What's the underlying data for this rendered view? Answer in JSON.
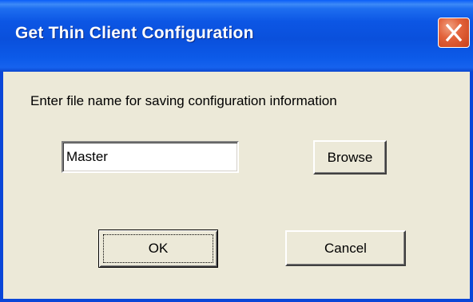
{
  "window": {
    "title": "Get Thin Client Configuration",
    "close_icon": "close-icon"
  },
  "dialog": {
    "prompt": "Enter file name for saving configuration information",
    "file_name_value": "Master",
    "browse_label": "Browse",
    "ok_label": "OK",
    "cancel_label": "Cancel"
  },
  "colors": {
    "titlebar": "#0a50dc",
    "client_bg": "#ece9d8",
    "close_button": "#e3643c"
  }
}
